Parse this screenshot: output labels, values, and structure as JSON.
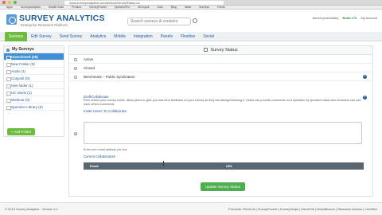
{
  "browser": {
    "url": "www.surveyanalytics.com/a/showSurveyStatus.do",
    "bookmarks": [
      "Apps",
      "SurveyAnalytics",
      "Mobile Suite",
      "Product",
      "SurveyPocket",
      "QuestionPro",
      "Micropoll",
      "Jobs",
      "Blog",
      "Ideas",
      "Surveys",
      "Feeds"
    ]
  },
  "header": {
    "logo_text": "SURVEY ANALYTICS",
    "tagline": "Enterprise Research Platform",
    "search_placeholder": "Search surveys & contacts",
    "user": "Admin (essentials)",
    "plan": "Build 170",
    "account": "My Account"
  },
  "nav": {
    "tabs": [
      "Surveys",
      "Edit Survey",
      "Send Survey",
      "Analytics",
      "Mobile",
      "Integration",
      "Panels",
      "Flexitive",
      "Social"
    ],
    "active_index": 0
  },
  "sidebar": {
    "title": "My Surveys",
    "items": [
      {
        "label": "Unarchived (28)"
      },
      {
        "label": "New Folder (0)"
      },
      {
        "label": "Audio (1)"
      },
      {
        "label": "Conjoint (0)"
      },
      {
        "label": "new folder (1)"
      },
      {
        "label": "UC Davis (1)"
      },
      {
        "label": "Webinar (0)"
      },
      {
        "label": "Question Library (0)"
      }
    ],
    "active_index": 0,
    "add_folder": "+ Add Folder"
  },
  "main": {
    "title": "Survey Status",
    "statuses": [
      {
        "label": "Active",
        "checked": false,
        "help": false
      },
      {
        "label": "Closed",
        "checked": false,
        "help": false
      },
      {
        "label": "Benchmark – Public Syndication",
        "checked": false,
        "help": true
      }
    ],
    "draft": {
      "title": "Draft/Collaborate",
      "description": "Peer review your survey online. Allow peers to give you real-time feedback on your survey as they are taking/reviewing it. Users can provide comments on a Question by Question basis and reviewers can see each others comments.",
      "invite_link": "Invite Users To Collaborate",
      "email_hint": "Enter one email address per line",
      "contacts_title": "Current Collaborators",
      "col_email": "Email",
      "col_url": "URL",
      "help_symbol": "?"
    },
    "update_button": "Update Survey Status"
  },
  "footer": {
    "copyright": "© 2013 Survey Analytics · Version 4.1",
    "products": "Products: FlexiCult | SurveyPocket | SurveySwipe | MicroPoll | MediaBurner | Research Access | LiveWire"
  }
}
